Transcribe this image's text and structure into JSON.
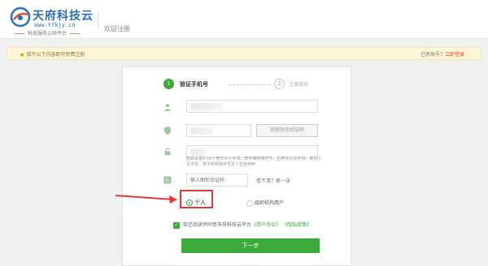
{
  "header": {
    "logo_cn": "天府科技云",
    "logo_url": "www.tfkjy.cn",
    "logo_sub": "科技服务公共平台",
    "page_title": "欢迎注册"
  },
  "notice": {
    "text": "填写以下内容即可免费注册",
    "login_prompt": "已有账号？",
    "login_link": "立即登录"
  },
  "steps": [
    {
      "num": "1",
      "label": "验证手机号"
    },
    {
      "num": "2",
      "label": "注册成功"
    }
  ],
  "form": {
    "sms_button": "获取短信验证码",
    "password_hint": "密码设置6-16个英文大小字母、数字或特殊符号，且英文大写字母、英文小写字母、数字和特殊符号至少包含两种",
    "captcha_placeholder": "输入图形验证码",
    "captcha_tip": "看不清？换一张",
    "radio_personal": "个人",
    "radio_org": "组织机构用户",
    "agree_text": "我已阅读并同意天府科技云平台",
    "agree_link_user": "《用户协议》",
    "agree_link_privacy": "《隐私政策》",
    "next_button": "下一步"
  },
  "colors": {
    "accent": "#3aaa3a",
    "annotation": "#e53935",
    "brand": "#2d6fb7"
  }
}
